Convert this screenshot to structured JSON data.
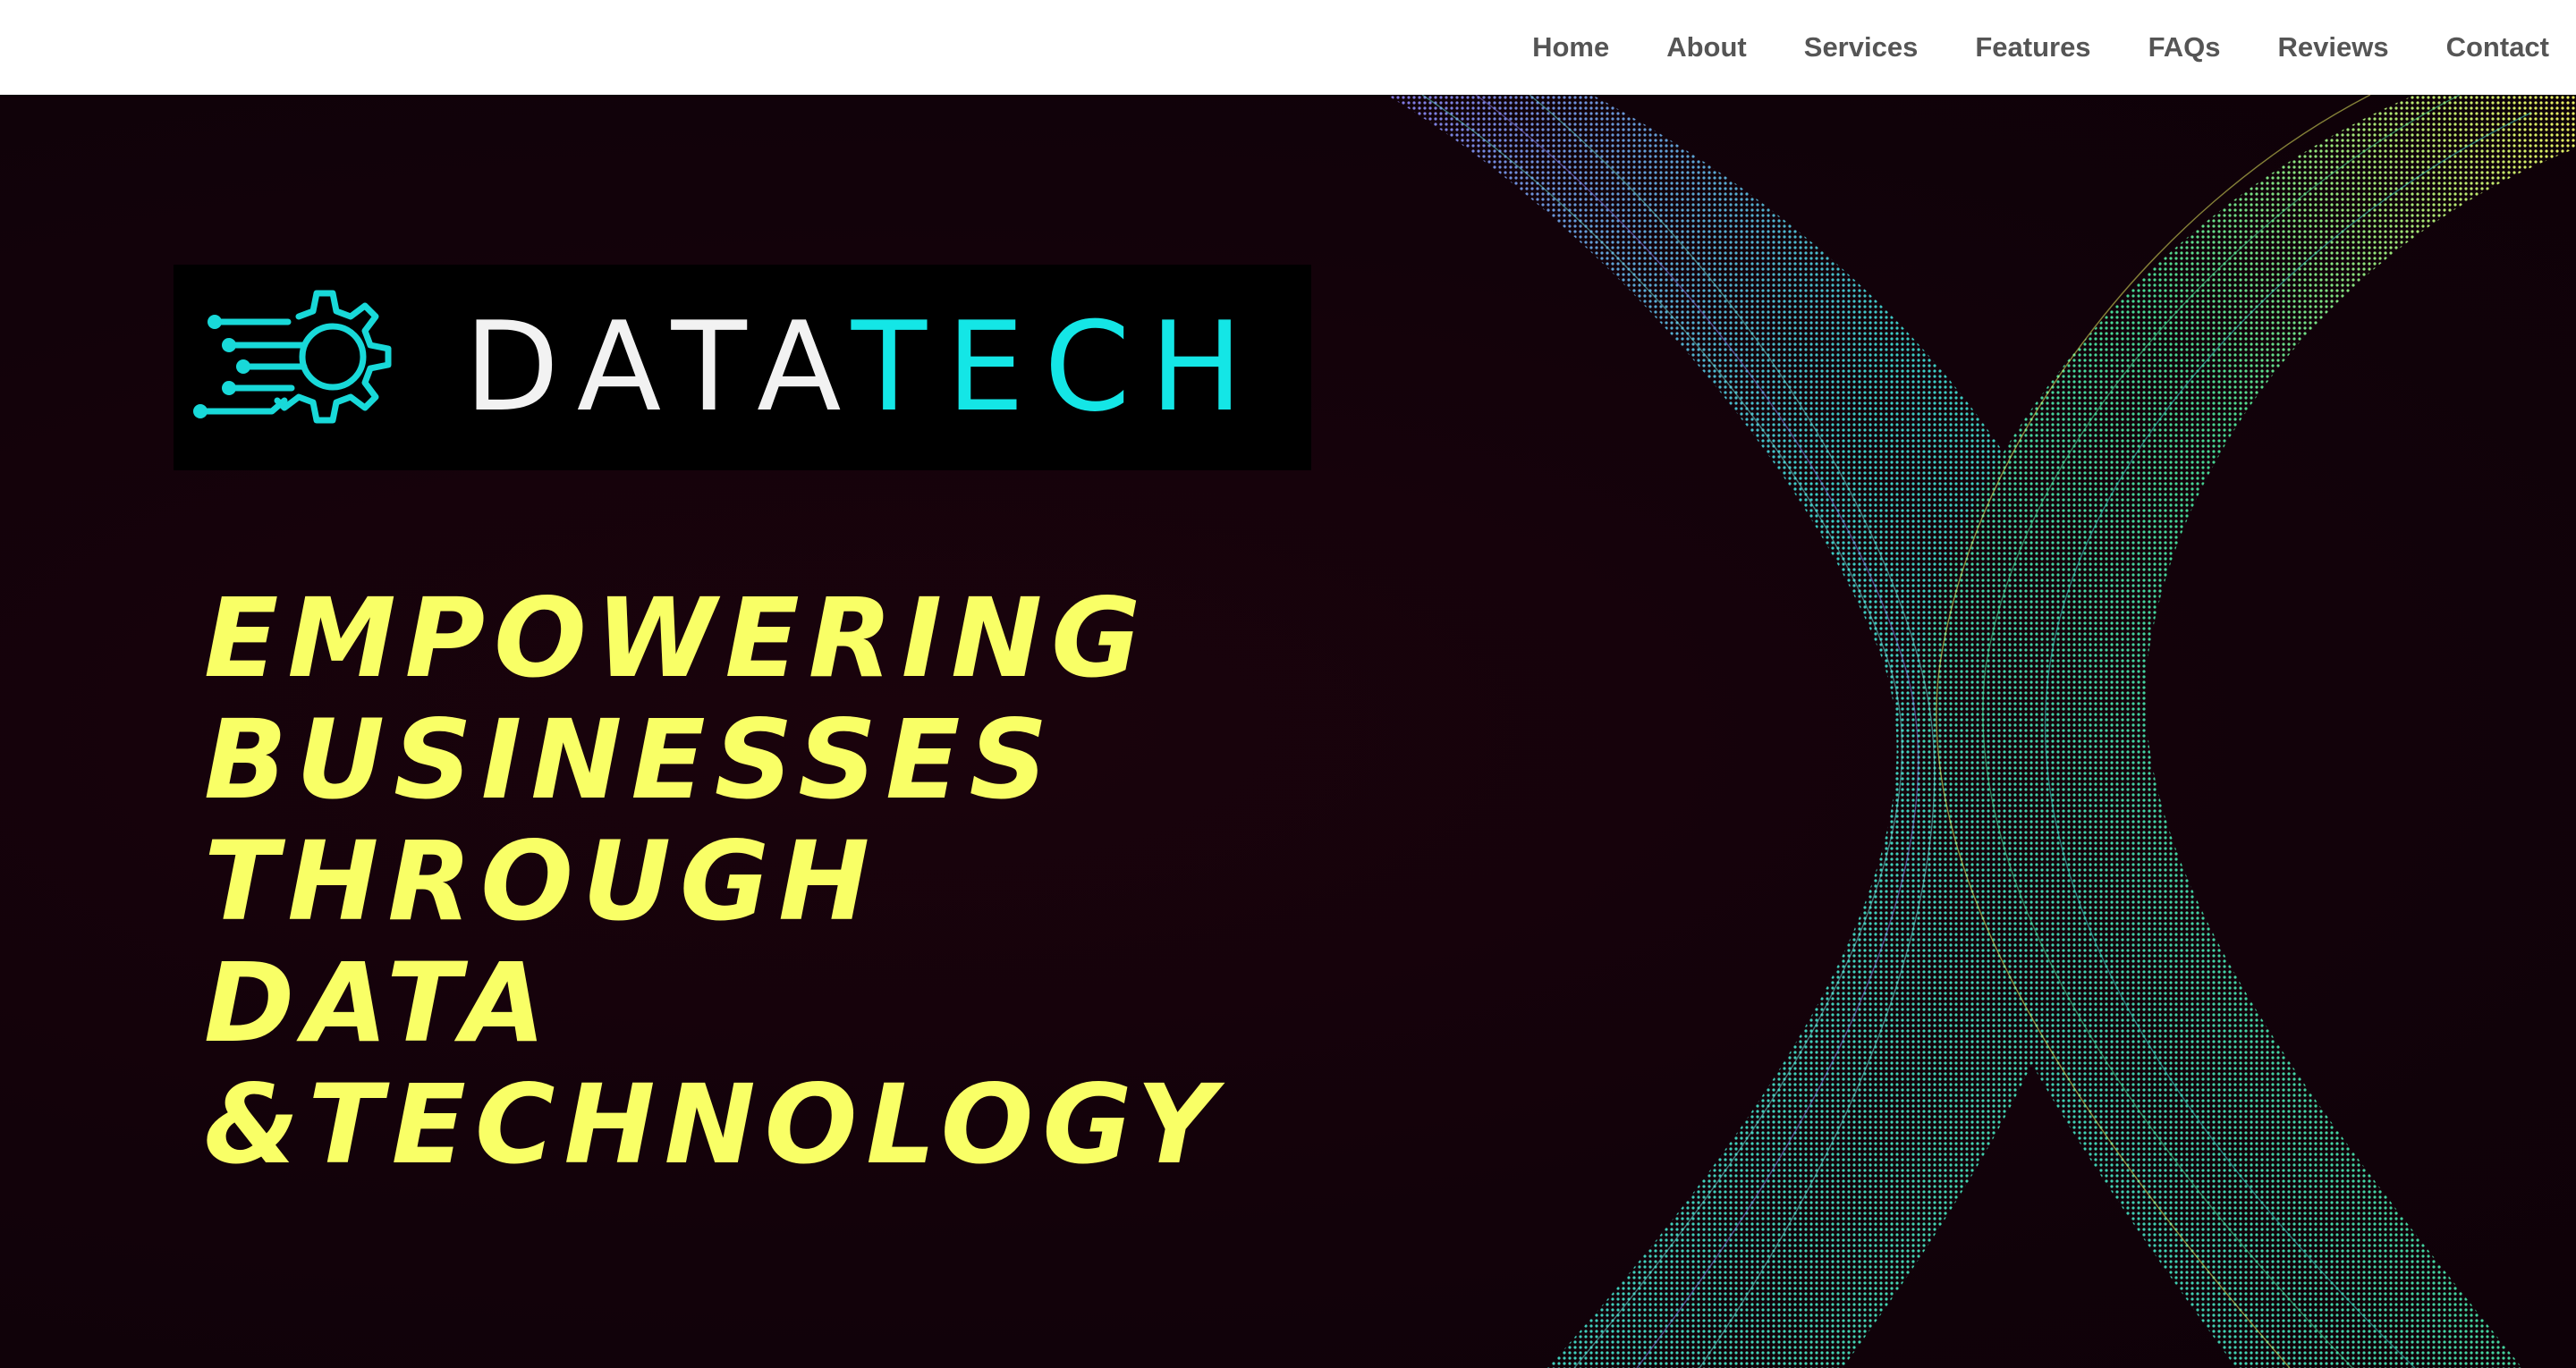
{
  "nav": {
    "items": [
      {
        "label": "Home"
      },
      {
        "label": "About"
      },
      {
        "label": "Services"
      },
      {
        "label": "Features"
      },
      {
        "label": "FAQs"
      },
      {
        "label": "Reviews"
      },
      {
        "label": "Contact"
      }
    ]
  },
  "logo": {
    "icon": "gear-circuit-icon",
    "text_primary": "DATA",
    "text_accent": "TECH"
  },
  "hero": {
    "headline_lines": [
      "EMPOWERING",
      "BUSINESSES",
      "THROUGH",
      "DATA",
      "&TECHNOLOGY"
    ],
    "background_art": "particle-wave"
  },
  "colors": {
    "nav_background": "#ffffff",
    "nav_text": "#555555",
    "hero_background": "#14020a",
    "headline": "#f9ff66",
    "logo_accent": "#14e6e6",
    "logo_text": "#f2f2f2",
    "wave_gradient": [
      "#3fd6d0",
      "#4be39a",
      "#f9ff66",
      "#8a7ff0"
    ]
  }
}
